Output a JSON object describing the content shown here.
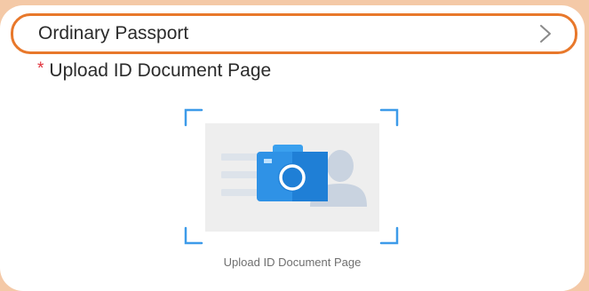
{
  "document_type": {
    "label": "Ordinary Passport",
    "chevron_icon": "chevron-right-icon"
  },
  "upload": {
    "required_marker": "*",
    "title": "Upload ID Document Page",
    "caption": "Upload ID Document Page",
    "placeholder_icon": "camera-icon",
    "colors": {
      "accent": "#e8782b",
      "camera_light": "#3aa0ee",
      "camera_dark": "#1f7fd6",
      "frame_corner": "#3d9be9",
      "silhouette": "#c9d3e0",
      "placeholder_bg": "#eeeeee"
    }
  }
}
